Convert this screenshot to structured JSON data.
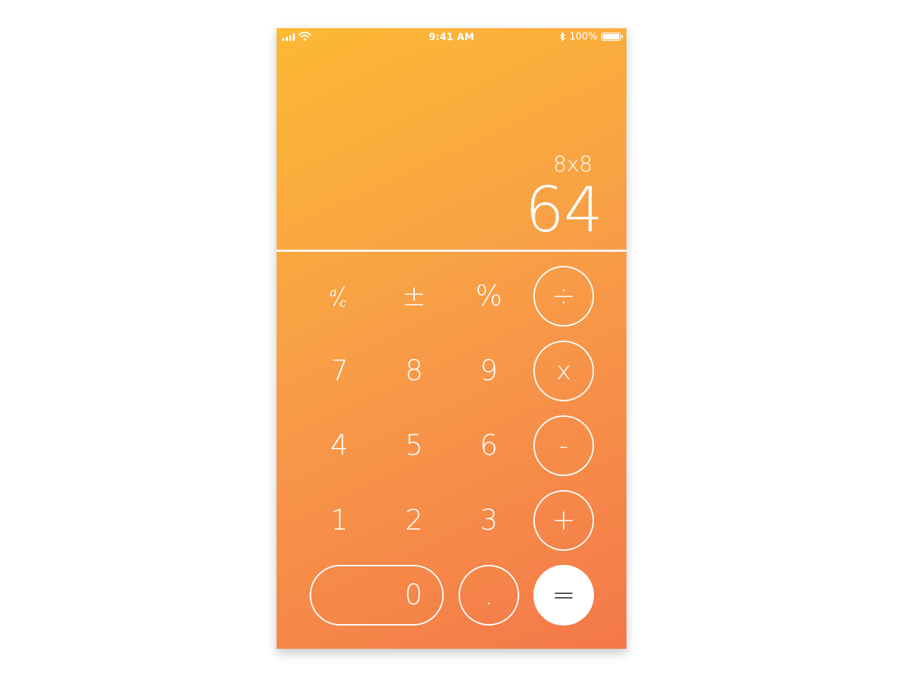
{
  "status_bar": {
    "time": "9:41 AM",
    "battery_text": "100%",
    "battery_level": 1.0,
    "signal_icon": "signal-bars-icon",
    "wifi_icon": "wifi-icon",
    "bluetooth_icon": "bluetooth-icon"
  },
  "display": {
    "expression": "8x8",
    "result": "64"
  },
  "keypad": {
    "row1": [
      "a/c",
      "±",
      "%",
      "÷"
    ],
    "row2": [
      "7",
      "8",
      "9",
      "x"
    ],
    "row3": [
      "4",
      "5",
      "6",
      "-"
    ],
    "row4": [
      "1",
      "2",
      "3",
      "+"
    ],
    "row5": [
      "0",
      ".",
      "="
    ]
  },
  "colors": {
    "gradient_start": "#FDB934",
    "gradient_mid": "#F89E47",
    "gradient_end": "#F4784A",
    "foreground": "#FFFFFF",
    "equals_text": "#222222"
  }
}
